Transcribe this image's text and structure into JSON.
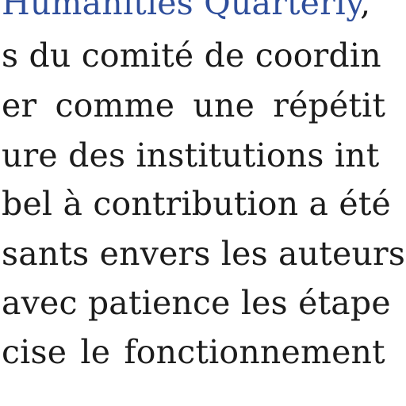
{
  "colors": {
    "text": "#1c1c1c",
    "link": "#2f4f9c",
    "background": "#ffffff"
  },
  "text": {
    "line1_link": "Humanities  Quarterly",
    "line1_tail": ",",
    "line2": "s du comité de coordin",
    "line3": "er  comme  une  répétit",
    "line4": "ure des institutions int",
    "line5": "bel à contribution a été",
    "line6": "sants envers les auteurs",
    "line7": "avec patience les étape",
    "line8": "cise le fonctionnement"
  }
}
